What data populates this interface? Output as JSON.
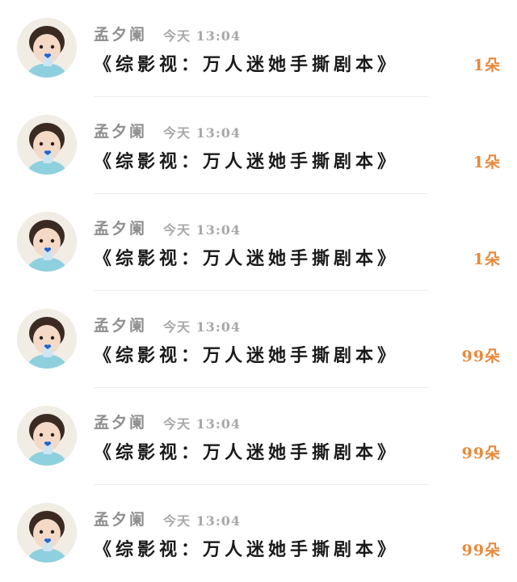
{
  "colors": {
    "name": "#8e8e8e",
    "time": "#a8a8a8",
    "title": "#1a1a1a",
    "count": "#e8893c"
  },
  "messages": [
    {
      "avatar": "child-avatar",
      "name": "孟夕阑",
      "time": "今天 13:04",
      "title": "《综影视：万人迷她手撕剧本》",
      "count": "1朵"
    },
    {
      "avatar": "child-avatar",
      "name": "孟夕阑",
      "time": "今天 13:04",
      "title": "《综影视：万人迷她手撕剧本》",
      "count": "1朵"
    },
    {
      "avatar": "child-avatar",
      "name": "孟夕阑",
      "time": "今天 13:04",
      "title": "《综影视：万人迷她手撕剧本》",
      "count": "1朵"
    },
    {
      "avatar": "child-avatar",
      "name": "孟夕阑",
      "time": "今天 13:04",
      "title": "《综影视：万人迷她手撕剧本》",
      "count": "99朵"
    },
    {
      "avatar": "child-avatar",
      "name": "孟夕阑",
      "time": "今天 13:04",
      "title": "《综影视：万人迷她手撕剧本》",
      "count": "99朵"
    },
    {
      "avatar": "child-avatar",
      "name": "孟夕阑",
      "time": "今天 13:04",
      "title": "《综影视：万人迷她手撕剧本》",
      "count": "99朵"
    }
  ]
}
